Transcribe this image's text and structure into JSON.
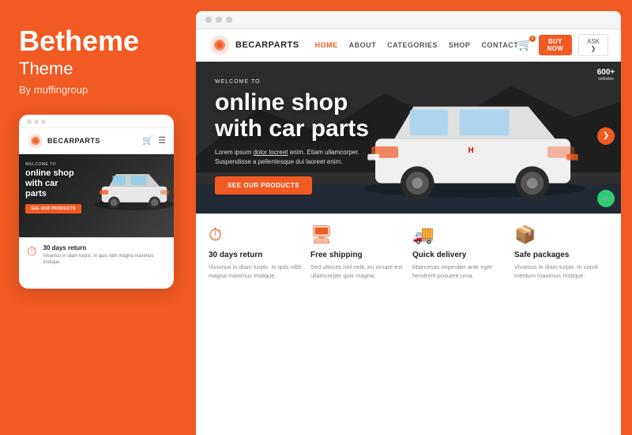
{
  "brand": {
    "title": "Betheme",
    "subtitle": "Theme",
    "author": "By muffingroup"
  },
  "mobile": {
    "logo_text": "BECARPARTS",
    "welcome": "WELCOME TO",
    "hero_title": "online shop\nwith car\nparts",
    "hero_btn": "SEE OUR PRODUCTS",
    "feature_title": "30 days return",
    "feature_desc": "Vivamus in diam turpis. In quis nibh magna maximus tristique."
  },
  "desktop": {
    "logo_text": "BECARPARTS",
    "nav": {
      "links": [
        "HOME",
        "ABOUT",
        "CATEGORIES",
        "SHOP",
        "CONTACT"
      ],
      "buy_now": "BUY NOW",
      "ask": "ASK ❯"
    },
    "hero": {
      "welcome": "WELCOME TO",
      "title_line1": "online shop",
      "title_line2": "with car parts",
      "desc": "Lorem ipsum dolor locreet enim. Etiam ullamcorper.\nSuspendisse a pellentesque dui laoreet enim.",
      "cta": "SEE OUR PRODUCTS",
      "stat_num": "600+",
      "stat_label": "websites"
    },
    "features": [
      {
        "icon": "⏱",
        "title": "30 days return",
        "desc": "Vivamus in diam turpis. In quis nibh magna maximus tristique."
      },
      {
        "icon": "🖥",
        "title": "Free shipping",
        "desc": "Sed ultrices nisl velit, eu ornare est ullamcorper quis magna."
      },
      {
        "icon": "🚚",
        "title": "Quick delivery",
        "desc": "Maecenas imperdiet ante eget hendrerit posuere uma."
      },
      {
        "icon": "📦",
        "title": "Safe packages",
        "desc": "Vivamus in diam turpis. In condi mentum maximus tristique."
      }
    ]
  }
}
